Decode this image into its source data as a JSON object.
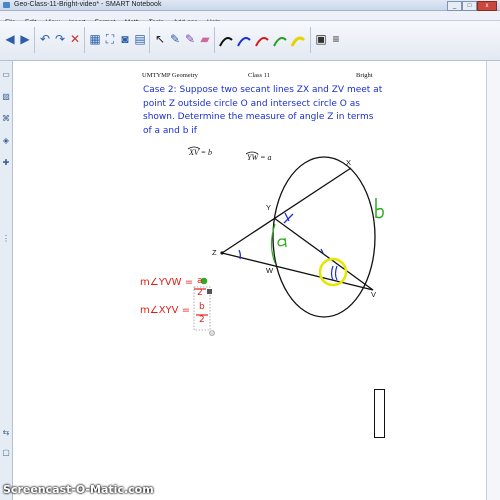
{
  "window": {
    "title": "Geo-Class-11-Bright-video* - SMART Notebook",
    "minimize": "_",
    "maximize": "□",
    "close": "x"
  },
  "menu": [
    "File",
    "Edit",
    "View",
    "Insert",
    "Format",
    "Math",
    "Tools",
    "Add-ons",
    "Help"
  ],
  "toolbar": {
    "icons": [
      "previous-page-icon",
      "next-page-icon",
      "undo-icon",
      "redo-icon",
      "delete-icon",
      "screen-shade-icon",
      "full-screen-icon",
      "document-camera-icon",
      "table-icon",
      "select-icon",
      "pen-icon",
      "creative-pen-icon",
      "eraser-icon",
      "line-icon",
      "shape-icon",
      "fill-icon",
      "text-icon",
      "properties-icon",
      "measure-icon",
      "magic-pen-icon"
    ]
  },
  "page": {
    "header_left": "UMTYMP Geometry",
    "header_center": "Class 11",
    "header_right": "Bright",
    "problem_text": "Case 2: Suppose two secant lines ZX and ZV meet at point Z outside circle O and intersect circle O as shown.  Determine the measure of angle Z in terms of a and b if",
    "arc_xv": "XV = b",
    "arc_yw": "YW = a",
    "points": {
      "x": "X",
      "y": "Y",
      "z": "Z",
      "w": "W",
      "v": "V"
    },
    "handwriting": {
      "eq1_left": "m∠YVW =",
      "eq1_num": "a",
      "eq1_den": "2",
      "eq2_left": "m∠XYV =",
      "eq2_num": "b",
      "eq2_den": "2",
      "arc_a": "a",
      "arc_b": "b",
      "angle_mark": "1"
    },
    "colors": {
      "problem": "#1a2fd6",
      "ink_red": "#e0211b",
      "ink_green": "#2faa22",
      "ink_blue": "#1a2fd6",
      "highlight": "#e6e600"
    }
  },
  "watermark": "Screencast-O-Matic.com"
}
